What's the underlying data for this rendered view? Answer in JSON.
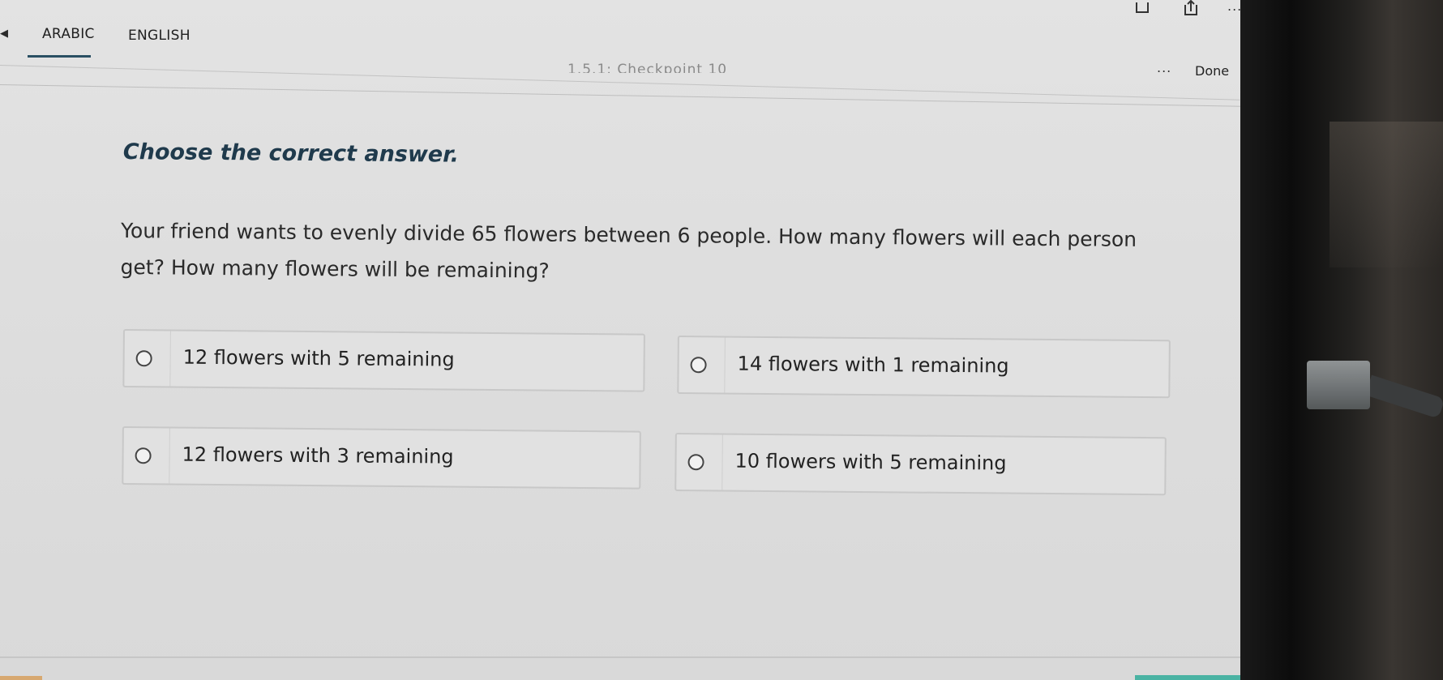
{
  "header": {
    "tabs": [
      {
        "label": "ARABIC",
        "active": true
      },
      {
        "label": "ENGLISH",
        "active": false
      }
    ],
    "checkpoint_title": "1.5.1: Checkpoint 10",
    "done_label": "Done",
    "more_label": "...",
    "top_more_label": "..."
  },
  "main": {
    "instruction": "Choose the correct answer.",
    "question": "Your friend wants to evenly divide 65 flowers between 6 people. How many flowers will each person get? How many flowers will be remaining?",
    "options": [
      {
        "label": "12 flowers with 5 remaining"
      },
      {
        "label": "14 flowers with 1 remaining"
      },
      {
        "label": "12 flowers with 3 remaining"
      },
      {
        "label": "10 flowers with 5 remaining"
      }
    ]
  },
  "colors": {
    "accent": "#2a4f63",
    "instruction_text": "#1f3a4c",
    "background": "#dedede"
  },
  "icons": [
    "back-icon",
    "bookmark-icon",
    "share-icon",
    "more-icon"
  ]
}
